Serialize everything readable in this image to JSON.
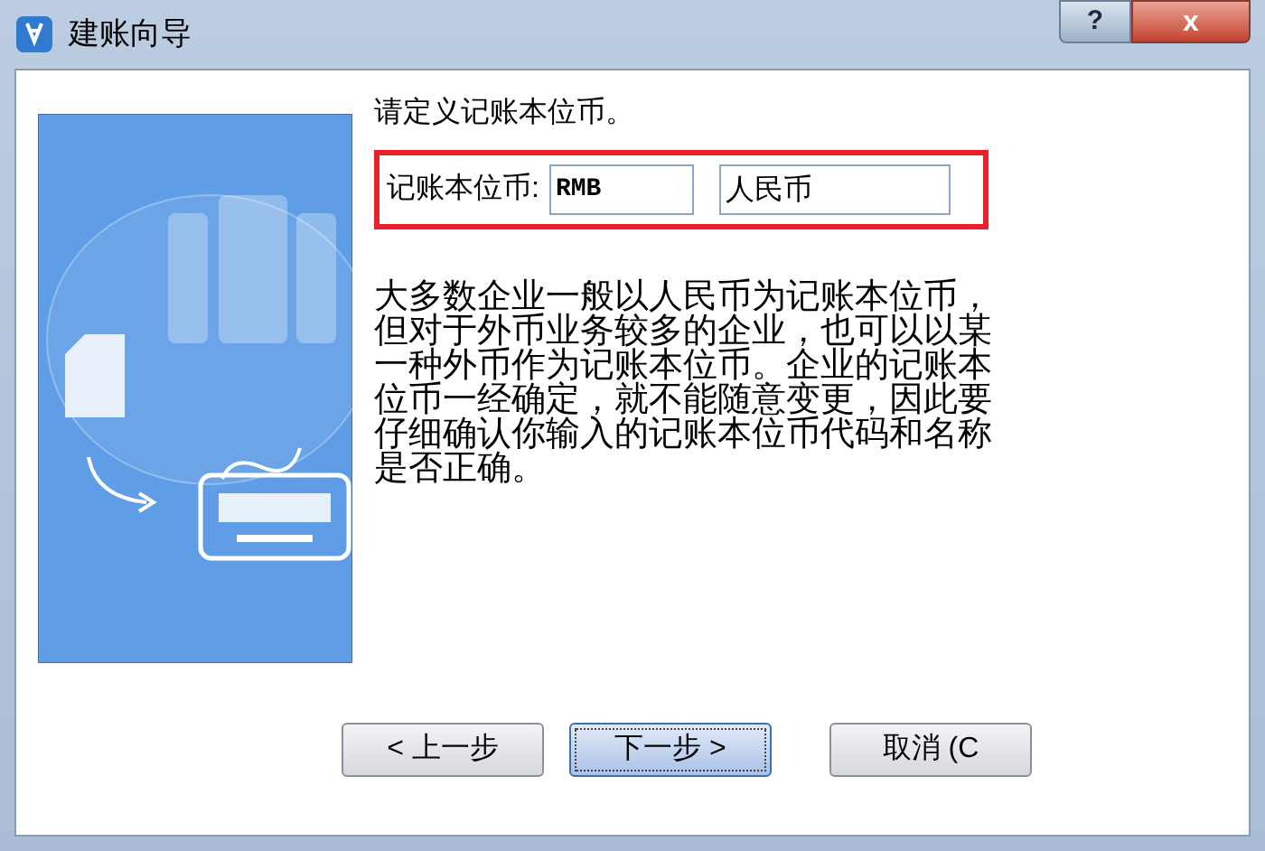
{
  "window": {
    "title": "建账向导",
    "help_button": "?",
    "close_button": "x"
  },
  "heading": "请定义记账本位币。",
  "currency": {
    "label": "记账本位币:",
    "code": "RMB",
    "name": "人民币"
  },
  "description": "大多数企业一般以人民币为记账本位币，但对于外币业务较多的企业，也可以以某一种外币作为记账本位币。企业的记账本位币一经确定，就不能随意变更，因此要仔细确认你输入的记账本位币代码和名称是否正确。",
  "buttons": [
    {
      "label": "< 上一步",
      "focused": false
    },
    {
      "label": "下一步 >",
      "focused": true
    },
    {
      "label": "取消 (C",
      "focused": false
    }
  ]
}
